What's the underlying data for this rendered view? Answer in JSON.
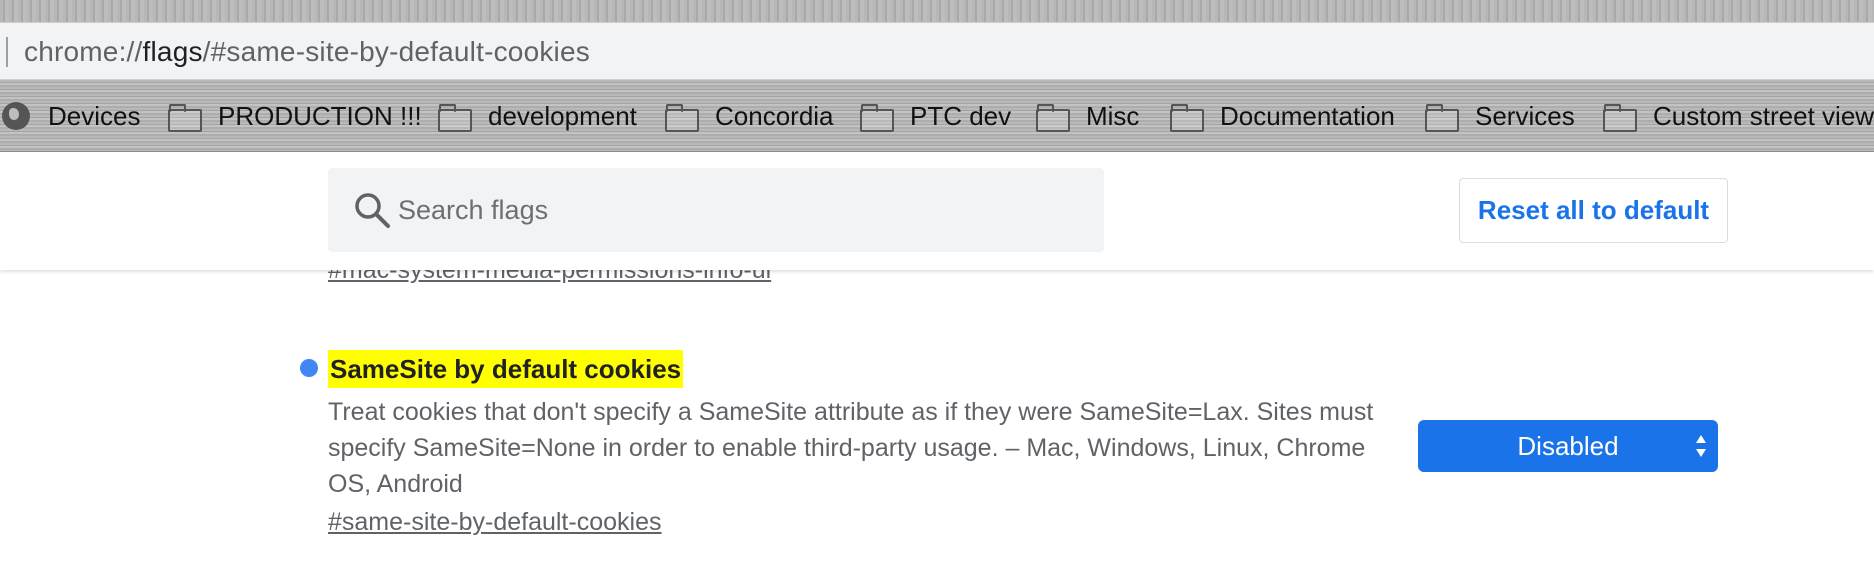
{
  "browser": {
    "url_prefix": "chrome://",
    "url_host": "flags",
    "url_path": "/#same-site-by-default-cookies"
  },
  "bookmarks": [
    {
      "label": "Devices",
      "icon": "globe-icon"
    },
    {
      "label": "PRODUCTION !!!",
      "icon": "folder-icon"
    },
    {
      "label": "development",
      "icon": "folder-icon"
    },
    {
      "label": "Concordia",
      "icon": "folder-icon"
    },
    {
      "label": "PTC dev",
      "icon": "folder-icon"
    },
    {
      "label": "Misc",
      "icon": "folder-icon"
    },
    {
      "label": "Documentation",
      "icon": "folder-icon"
    },
    {
      "label": "Services",
      "icon": "folder-icon"
    },
    {
      "label": "Custom street view",
      "icon": "folder-icon"
    }
  ],
  "header": {
    "search_placeholder": "Search flags",
    "reset_label": "Reset all to default"
  },
  "previous_flag": {
    "link": "#mac-system-media-permissions-info-ui"
  },
  "flag": {
    "title": "SameSite by default cookies",
    "description": "Treat cookies that don't specify a SameSite attribute as if they were SameSite=Lax. Sites must specify SameSite=None in order to enable third-party usage. – Mac, Windows, Linux, Chrome OS, Android",
    "link": "#same-site-by-default-cookies",
    "selected_option": "Disabled"
  },
  "colors": {
    "accent": "#1a73e8",
    "highlight": "#ffff00",
    "modified_dot": "#4285f4"
  }
}
